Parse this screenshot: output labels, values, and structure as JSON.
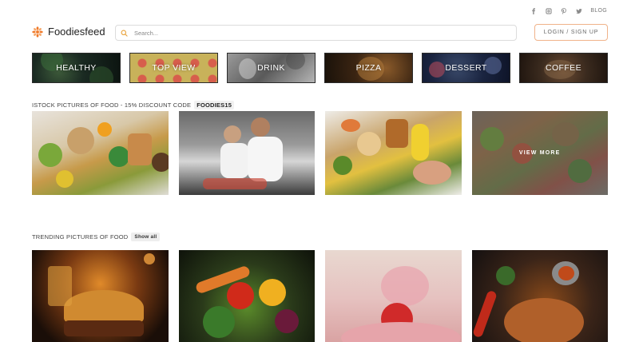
{
  "social": {
    "icons": [
      "facebook-icon",
      "instagram-icon",
      "pinterest-icon",
      "twitter-icon"
    ],
    "blog_label": "BLOG"
  },
  "header": {
    "logo_text": "Foodiesfeed",
    "search_placeholder": "Search...",
    "login_label": "LOGIN / SIGN UP"
  },
  "categories": [
    {
      "label": "HEALTHY"
    },
    {
      "label": "TOP VIEW"
    },
    {
      "label": "DRINK"
    },
    {
      "label": "PIZZA"
    },
    {
      "label": "DESSERT"
    },
    {
      "label": "COFFEE"
    }
  ],
  "istock": {
    "title": "ISTOCK PICTURES OF FOOD - 15% DISCOUNT CODE",
    "code": "FOODIES15",
    "view_more": "VIEW MORE"
  },
  "trending": {
    "title": "TRENDING PICTURES OF FOOD",
    "show_all": "Show all"
  },
  "colors": {
    "accent": "#f0b38a",
    "logo_orange": "#f07a2a"
  }
}
